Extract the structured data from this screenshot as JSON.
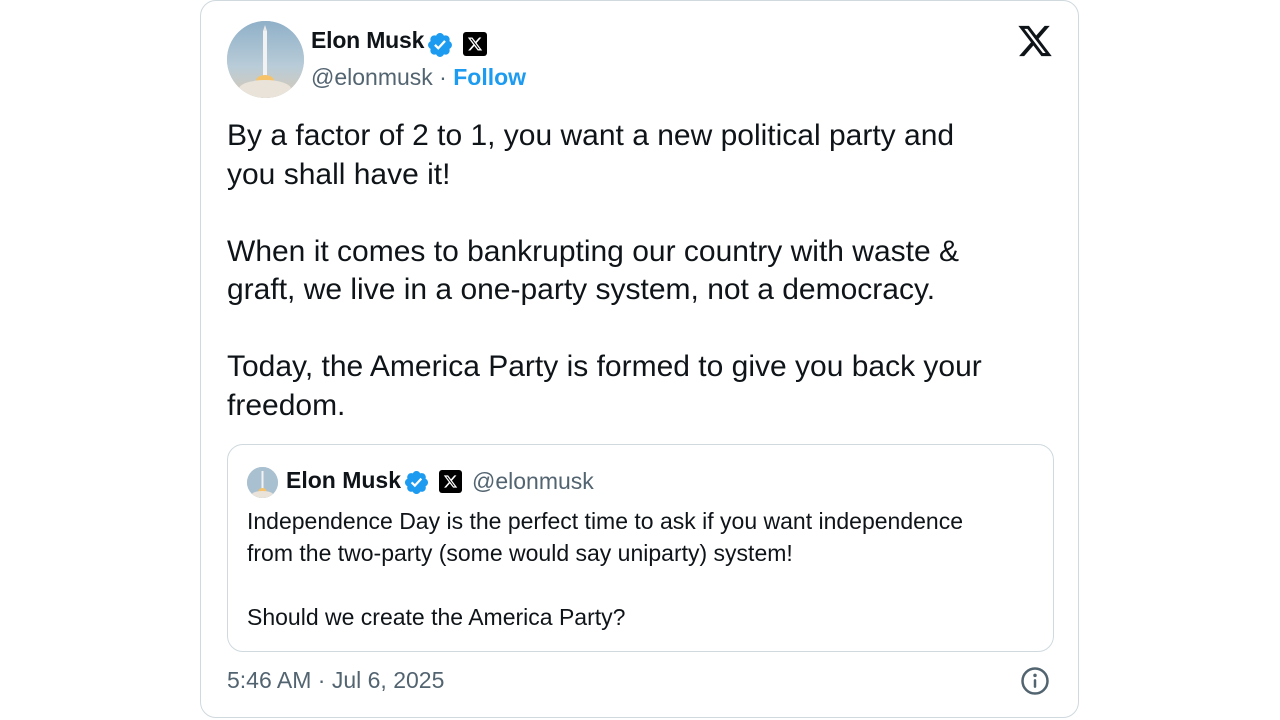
{
  "author": {
    "name": "Elon Musk",
    "handle": "@elonmusk",
    "separator": " · ",
    "follow_label": "Follow"
  },
  "icons": {
    "verified": "verified-badge-icon",
    "affiliate": "x-affiliate-badge-icon",
    "brand": "x-logo-icon",
    "info": "info-icon"
  },
  "colors": {
    "accent": "#1d9bf0",
    "text": "#0f1419",
    "muted": "#536471",
    "border": "#cfd9de"
  },
  "tweet": {
    "text": "By a factor of 2 to 1, you want a new political party and\nyou shall have it!\n\nWhen it comes to bankrupting our country with waste &\ngraft, we live in a one-party system, not a democracy.\n\nToday, the America Party is formed to give you back your\nfreedom."
  },
  "quote": {
    "name": "Elon Musk",
    "handle": "@elonmusk",
    "text": "Independence Day is the perfect time to ask if you want independence\nfrom the two-party (some would say uniparty) system!\n\nShould we create the America Party?"
  },
  "timestamp": "5:46 AM · Jul 6, 2025"
}
